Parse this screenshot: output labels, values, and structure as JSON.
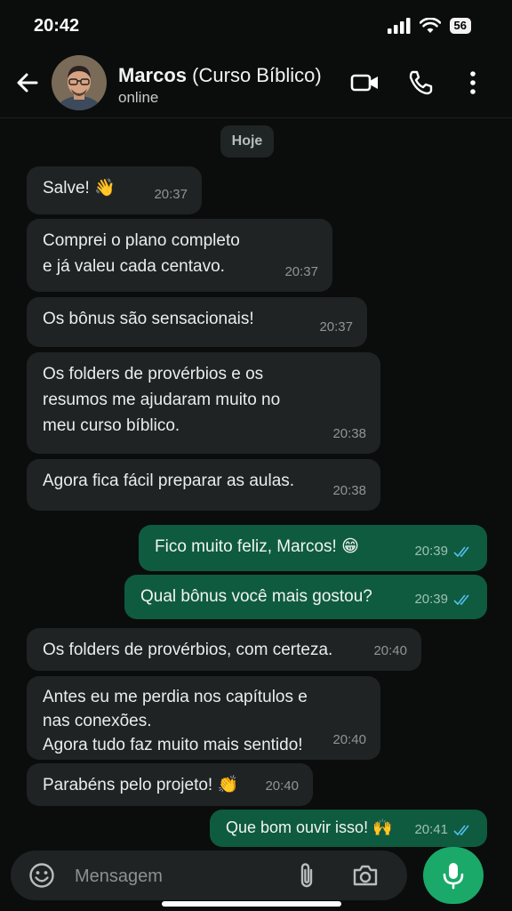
{
  "status": {
    "time": "20:42",
    "battery": "56"
  },
  "header": {
    "name": "Marcos",
    "name_suffix": "(Curso Bíblico)",
    "status": "online"
  },
  "date_chip": "Hoje",
  "messages": [
    {
      "dir": "in",
      "text": "Salve! 👋",
      "time": "20:37"
    },
    {
      "dir": "in",
      "text": "Comprei o plano completo\ne já valeu cada centavo.",
      "time": "20:37"
    },
    {
      "dir": "in",
      "text": "Os bônus são sensacionais!",
      "time": "20:37"
    },
    {
      "dir": "in",
      "text": "Os folders de provérbios e os\nresumos me ajudaram muito no\nmeu curso bíblico.",
      "time": "20:38"
    },
    {
      "dir": "in",
      "text": "Agora fica fácil preparar as aulas.",
      "time": "20:38"
    },
    {
      "dir": "out",
      "text": "Fico muito feliz, Marcos! 😁",
      "time": "20:39",
      "read": true
    },
    {
      "dir": "out",
      "text": "Qual bônus você mais gostou?",
      "time": "20:39",
      "read": true
    },
    {
      "dir": "in",
      "text": "Os folders de provérbios, com certeza.",
      "time": "20:40"
    },
    {
      "dir": "in",
      "text": "Antes eu me perdia nos capítulos e\nnas conexões.\nAgora tudo faz muito mais sentido!",
      "time": "20:40"
    },
    {
      "dir": "in",
      "text": "Parabéns pelo projeto! 👏",
      "time": "20:40"
    },
    {
      "dir": "out",
      "text": "Que bom ouvir isso! 🙌",
      "time": "20:41",
      "read": true
    }
  ],
  "composer": {
    "placeholder": "Mensagem"
  },
  "icons": {
    "back": "arrow-left-icon",
    "video": "video-camera-icon",
    "call": "phone-icon",
    "menu": "more-vertical-icon",
    "emoji": "emoji-icon",
    "attach": "paperclip-icon",
    "camera": "camera-icon",
    "mic": "microphone-icon",
    "ticks": "double-check-icon"
  },
  "colors": {
    "incoming": "#1f2324",
    "outgoing": "#0f5b3f",
    "read_ticks": "#53bdeb",
    "mic": "#1aa969"
  }
}
